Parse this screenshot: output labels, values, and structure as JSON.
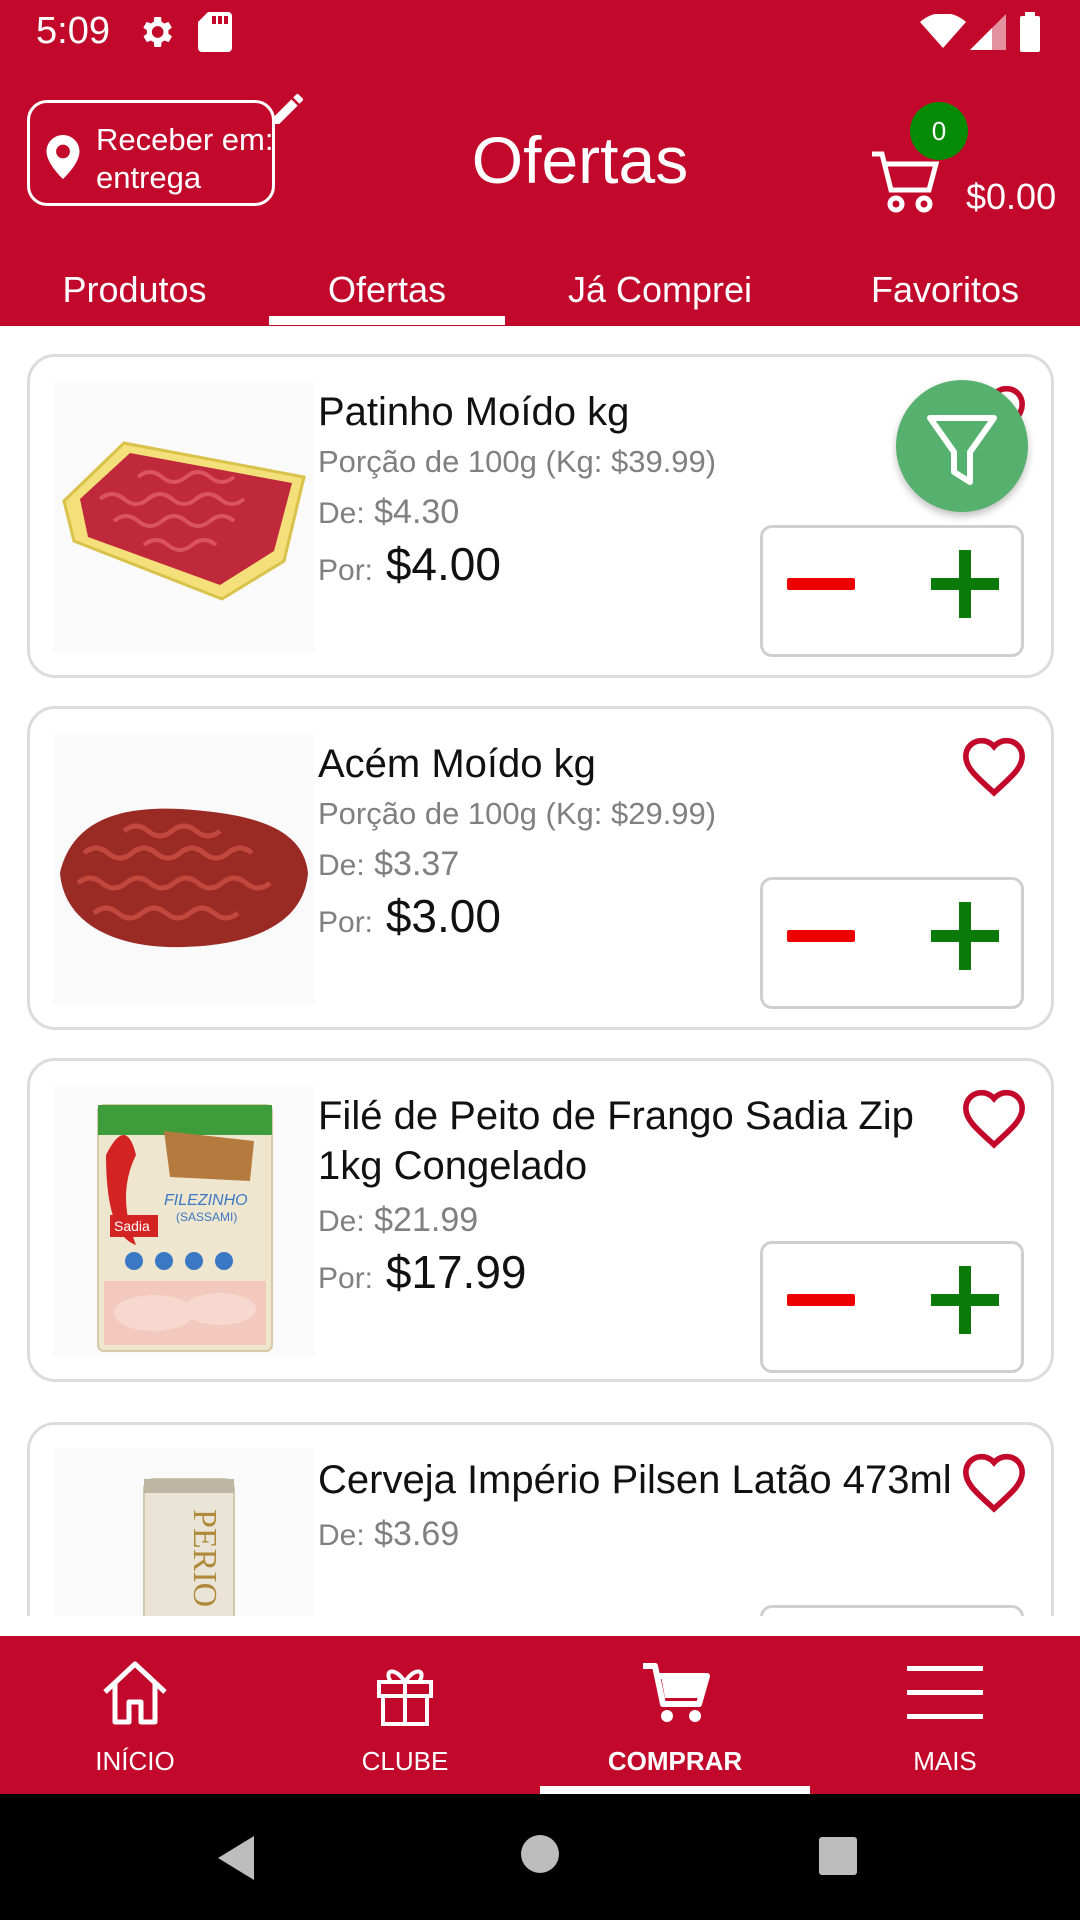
{
  "status_bar": {
    "time": "5:09"
  },
  "header": {
    "location_label": "Receber em:",
    "location_value": "entrega",
    "title": "Ofertas",
    "cart_count": "0",
    "cart_total": "$0.00"
  },
  "tabs": [
    {
      "label": "Produtos"
    },
    {
      "label": "Ofertas"
    },
    {
      "label": "Já Comprei"
    },
    {
      "label": "Favoritos"
    }
  ],
  "active_tab": "Ofertas",
  "products": [
    {
      "name": "Patinho Moído kg",
      "portion": "Porção de 100g (Kg: $39.99)",
      "old_label": "De:",
      "old_price": "$4.30",
      "new_label": "Por:",
      "new_price": "$4.00"
    },
    {
      "name": "Acém Moído kg",
      "portion": "Porção de 100g (Kg: $29.99)",
      "old_label": "De:",
      "old_price": "$3.37",
      "new_label": "Por:",
      "new_price": "$3.00"
    },
    {
      "name": "Filé de Peito de Frango Sadia Zip 1kg Congelado",
      "old_label": "De:",
      "old_price": "$21.99",
      "new_label": "Por:",
      "new_price": "$17.99"
    },
    {
      "name": "Cerveja Império Pilsen Latão 473ml",
      "old_label": "De:",
      "old_price": "$3.69"
    }
  ],
  "product_images": {
    "sadia_brand": "Sadia",
    "sadia_text": "FILEZINHO",
    "sadia_sub": "(SASSAMI)",
    "can_text": "PERIO"
  },
  "bottom_nav": [
    {
      "label": "INÍCIO",
      "icon": "home-icon"
    },
    {
      "label": "CLUBE",
      "icon": "gift-icon"
    },
    {
      "label": "COMPRAR",
      "icon": "cart-icon"
    },
    {
      "label": "MAIS",
      "icon": "menu-icon"
    }
  ],
  "active_nav": "COMPRAR",
  "colors": {
    "brand": "#c2092b",
    "badge": "#068b06",
    "filter": "#56b06e",
    "minus": "#ee0000",
    "plus": "#0b7a0b"
  }
}
